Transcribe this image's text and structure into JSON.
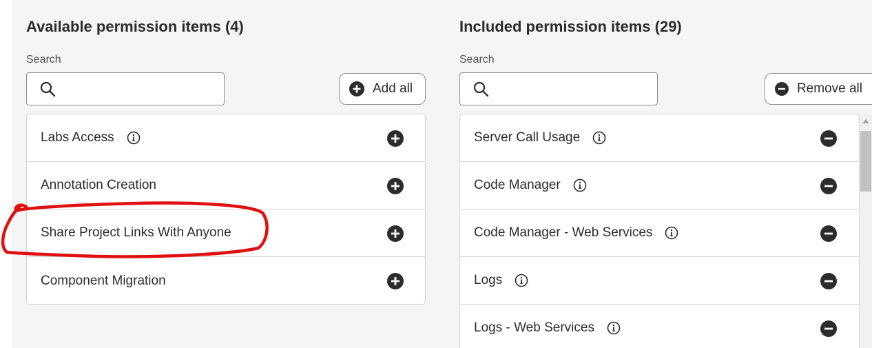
{
  "available": {
    "heading": "Available permission items (4)",
    "search_label": "Search",
    "search_value": "",
    "add_all_label": "Add all",
    "items": [
      {
        "label": "Labs Access",
        "info": true
      },
      {
        "label": "Annotation Creation",
        "info": false
      },
      {
        "label": "Share Project Links With Anyone",
        "info": false
      },
      {
        "label": "Component Migration",
        "info": false
      }
    ]
  },
  "included": {
    "heading": "Included permission items (29)",
    "search_label": "Search",
    "search_value": "",
    "remove_all_label": "Remove all",
    "items": [
      {
        "label": "Server Call Usage",
        "info": true
      },
      {
        "label": "Code Manager",
        "info": true
      },
      {
        "label": "Code Manager - Web Services",
        "info": true
      },
      {
        "label": "Logs",
        "info": true
      },
      {
        "label": "Logs - Web Services",
        "info": true
      }
    ]
  },
  "icons": {
    "search": "search-icon",
    "add": "plus-circle-icon",
    "remove": "minus-circle-icon",
    "info": "info-icon"
  },
  "colors": {
    "panel_background": "#f5f5f5",
    "icon_dark": "#2c2c2c",
    "annotation_red": "#e01010",
    "border": "#d3d3d3"
  }
}
